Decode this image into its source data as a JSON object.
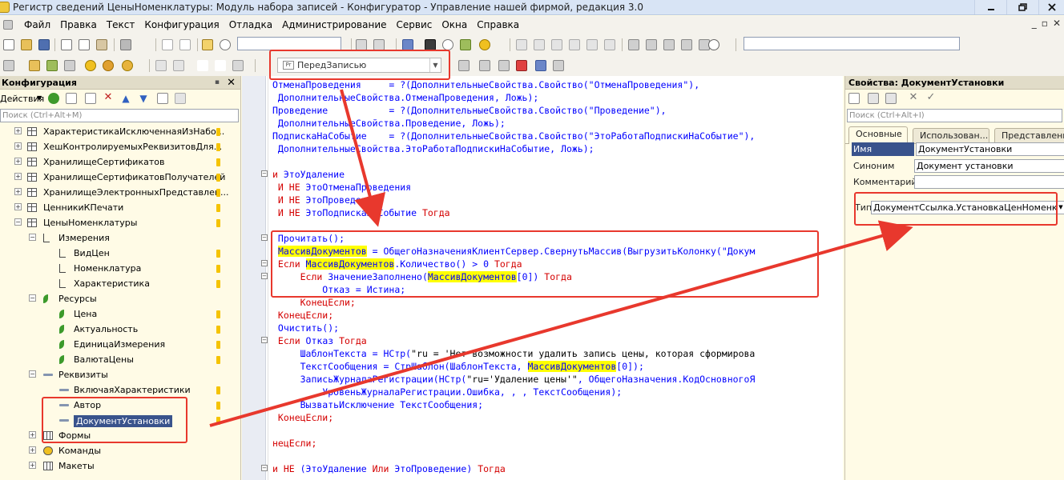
{
  "window": {
    "title": "Регистр сведений ЦеныНоменклатуры: Модуль набора записей - Конфигуратор - Управление нашей фирмой, редакция 3.0"
  },
  "menu": [
    "Файл",
    "Правка",
    "Текст",
    "Конфигурация",
    "Отладка",
    "Администрирование",
    "Сервис",
    "Окна",
    "Справка"
  ],
  "editor_toolbar": {
    "procedure_combo": "ПередЗаписью",
    "procedure_icon": "Pr"
  },
  "left_panel": {
    "title": "Конфигурация",
    "actions_label": "Действия",
    "search_placeholder": "Поиск (Ctrl+Alt+M)",
    "tree": [
      {
        "label": "ХарактеристикаИсключеннаяИзНабо...",
        "icon": "register-icon",
        "level": 1
      },
      {
        "label": "ХешКонтролируемыхРеквизитовДля...",
        "icon": "register-icon",
        "level": 1
      },
      {
        "label": "ХранилищеСертификатов",
        "icon": "register-icon",
        "level": 1
      },
      {
        "label": "ХранилищеСертификатовПолучателей",
        "icon": "register-icon",
        "level": 1
      },
      {
        "label": "ХранилищеЭлектронныхПредставлен...",
        "icon": "register-icon",
        "level": 1
      },
      {
        "label": "ЦенникиКПечати",
        "icon": "register-icon",
        "level": 1
      },
      {
        "label": "ЦеныНоменклатуры",
        "icon": "register-icon",
        "level": 1
      },
      {
        "label": "Измерения",
        "icon": "dimension-icon",
        "level": 2
      },
      {
        "label": "ВидЦен",
        "icon": "dimension-icon",
        "level": 3
      },
      {
        "label": "Номенклатура",
        "icon": "dimension-icon",
        "level": 3
      },
      {
        "label": "Характеристика",
        "icon": "dimension-icon",
        "level": 3
      },
      {
        "label": "Ресурсы",
        "icon": "resource-icon",
        "level": 2
      },
      {
        "label": "Цена",
        "icon": "resource-icon",
        "level": 3
      },
      {
        "label": "Актуальность",
        "icon": "resource-icon",
        "level": 3
      },
      {
        "label": "ЕдиницаИзмерения",
        "icon": "resource-icon",
        "level": 3
      },
      {
        "label": "ВалютаЦены",
        "icon": "resource-icon",
        "level": 3
      },
      {
        "label": "Реквизиты",
        "icon": "attribute-icon",
        "level": 2
      },
      {
        "label": "ВключаяХарактеристики",
        "icon": "attribute-icon",
        "level": 3
      },
      {
        "label": "Автор",
        "icon": "attribute-icon",
        "level": 3
      },
      {
        "label": "ДокументУстановки",
        "icon": "attribute-icon",
        "level": 3
      },
      {
        "label": "Формы",
        "icon": "forms-icon",
        "level": 2
      },
      {
        "label": "Команды",
        "icon": "commands-icon",
        "level": 2
      },
      {
        "label": "Макеты",
        "icon": "templates-icon",
        "level": 2
      }
    ]
  },
  "code": {
    "l1": "ОтменаПроведения     = ?(ДополнительныеСвойства.Свойство(\"ОтменаПроведения\"),",
    "l2": " ДополнительныеСвойства.ОтменаПроведения, Ложь);",
    "l3": "Проведение           = ?(ДополнительныеСвойства.Свойство(\"Проведение\"),",
    "l4": " ДополнительныеСвойства.Проведение, Ложь);",
    "l5": "ПодпискаНаСобытие    = ?(ДополнительныеСвойства.Свойство(\"ЭтоРаботаПодпискиНаСобытие\"),",
    "l6": " ДополнительныеСвойства.ЭтоРаботаПодпискиНаСобытие, Ложь);",
    "l8_kw": "и ",
    "l8": "ЭтоУдаление",
    "l9_kw": " И НЕ ",
    "l9": "ЭтоОтменаПроведения",
    "l10_kw": " И НЕ ",
    "l10": "ЭтоПроведение",
    "l11_kw": " И НЕ ",
    "l11": "ЭтоПодпискаНаСобытие ",
    "l11_kw2": "Тогда",
    "l13": " Прочитать();",
    "l14_hl": "МассивДокументов",
    "l14": " = ОбщегоНазначенияКлиентСервер.СвернутьМассив(ВыгрузитьКолонку(\"Докум",
    "l15_kw": " Если ",
    "l15_hl": "МассивДокументов",
    "l15": ".Количество() > 0 ",
    "l15_kw2": "Тогда",
    "l16_kw": "     Если ",
    "l16a": "ЗначениеЗаполнено(",
    "l16_hl": "МассивДокументов",
    "l16b": "[0]) ",
    "l16_kw2": "Тогда",
    "l17": "         Отказ = Истина;",
    "l18_kw": "     КонецЕсли;",
    "l19_kw": " КонецЕсли;",
    "l20": " Очистить();",
    "l21_kw": " Если ",
    "l21": "Отказ ",
    "l21_kw2": "Тогда",
    "l22a": "     ШаблонТекста = НСтр(",
    "l22s": "\"ru = 'Нет возможности удалить запись цены, которая сформирова",
    "l23a": "     ТекстСообщения = СтрШаблон(ШаблонТекста, ",
    "l23_hl": "МассивДокументов",
    "l23b": "[0]);",
    "l24a": "     ЗаписьЖурналаРегистрации(НСтр(",
    "l24s": "\"ru='Удаление цены'\"",
    "l24b": ", ОбщегоНазначения.КодОсновногоЯ",
    "l25": "         УровеньЖурналаРегистрации.Ошибка, , , ТекстСообщения);",
    "l26": "     ВызватьИсключение ТекстСообщения;",
    "l27_kw": " КонецЕсли;",
    "l29_kw": "нецЕсли;",
    "l31_kw": "и НЕ ",
    "l31": "(ЭтоУдаление ",
    "l31_kw2": "Или ",
    "l31b": "ЭтоПроведение) ",
    "l31_kw3": "Тогда"
  },
  "right_panel": {
    "title": "Свойства: ДокументУстановки",
    "search_placeholder": "Поиск (Ctrl+Alt+I)",
    "tabs": [
      "Основные",
      "Использован...",
      "Представление"
    ],
    "properties": [
      {
        "label": "Имя",
        "value": "ДокументУстановки"
      },
      {
        "label": "Синоним",
        "value": "Документ установки"
      },
      {
        "label": "Комментарий",
        "value": ""
      }
    ],
    "type_label": "Тип",
    "type_value": "ДокументСсылка.УстановкаЦенНоменклат"
  },
  "colors": {
    "annotation_red": "#e8382d",
    "highlight": "#ffff00",
    "keyword": "#d40000",
    "identifier": "#0000ff"
  }
}
